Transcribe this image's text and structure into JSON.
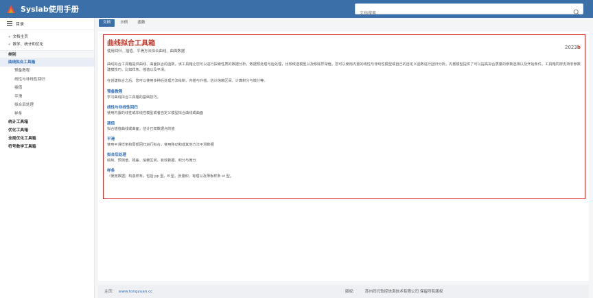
{
  "header": {
    "app_title": "Syslab使用手册",
    "search_placeholder": "文档搜索"
  },
  "sidebar": {
    "toc_label": "目录",
    "links": [
      "文档主页",
      "数学、统计和优化"
    ],
    "category_label": "类别",
    "active_item": "曲线拟合工具箱",
    "sub_items": [
      "预备教程",
      "线性与非线性回归",
      "插值",
      "平滑",
      "拟合后处理",
      "样条"
    ],
    "sections": [
      "统计工具箱",
      "优化工具箱",
      "全局优化工具箱",
      "符号数学工具箱"
    ]
  },
  "tabs": [
    {
      "label": "文档",
      "active": true
    },
    {
      "label": "示例",
      "active": false
    },
    {
      "label": "函数",
      "active": false
    }
  ],
  "doc": {
    "title": "曲线拟合工具箱",
    "subtitle": "使用回归、插值、平滑方法拟合曲线、曲面数据",
    "version_year": "2023",
    "version_suffix": "b",
    "para1": "曲线拟合工具箱提供曲线、曲面拟合的函数。该工具箱让您可以进行探索性质的数据分析，数据预处理与后处理，比较候选模型以及移除异常值。您可以使用内置的线性与非线性模型或自己的自定义函数进行回归分析。内置模型提供了可以提高拟合质量的参数选择以及开始条件。工具箱同样支持非参数建模技巧，比如样条、插值以及平滑。",
    "para2": "在创建拟合之后，您可以使用多种后处理方法绘制、内插与外插、估计信赖区间、计算积分与微分等。",
    "sections": [
      {
        "title": "预备教程",
        "desc": "学习曲线拟合工具箱的基础技巧。"
      },
      {
        "title": "线性与非线性回归",
        "desc": "使用内置的线性或非线性模型或者自定义模型拟合曲线或曲面"
      },
      {
        "title": "插值",
        "desc": "拟合插值曲线或曲面，估计已知数据点的值"
      },
      {
        "title": "平滑",
        "desc": "使用平滑样条和局部回归进行拟合，使用移动和或其他方法平滑数据"
      },
      {
        "title": "拟合后处理",
        "desc": "绘制、预测值、残差、信赖区间、有效数据、积分与微分"
      },
      {
        "title": "样条",
        "desc": "（使用数据）构造样条，包括 pp 型、B 型、张量积、有理以及薄板样条 st 型。"
      }
    ]
  },
  "footer": {
    "homepage_label": "主页：",
    "homepage_url": "www.tongyuan.cc",
    "copyright_label": "版权：",
    "company": "苏州同元软控信息技术有限公司 保留所有版权"
  },
  "colors": {
    "header_bg": "#3a6fa8",
    "accent": "#2f6db5",
    "title_red": "#c0392b",
    "highlight_border": "#e02424"
  }
}
